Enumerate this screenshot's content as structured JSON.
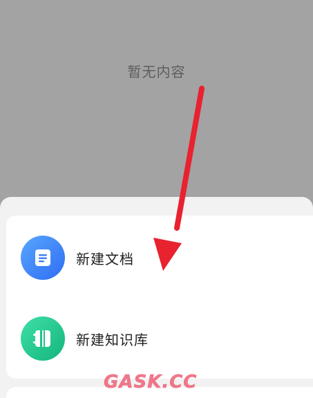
{
  "empty_state": {
    "text": "暂无内容",
    "illustration_icon": "empty-box-illustration"
  },
  "sheet": {
    "actions": [
      {
        "label": "新建文档",
        "icon": "document-icon",
        "color": "#2f6df2"
      },
      {
        "label": "新建知识库",
        "icon": "notebook-icon",
        "color": "#14b57c"
      }
    ]
  },
  "overlay": {
    "arrow_color": "#e8222f",
    "watermark": "GASK.CC"
  }
}
